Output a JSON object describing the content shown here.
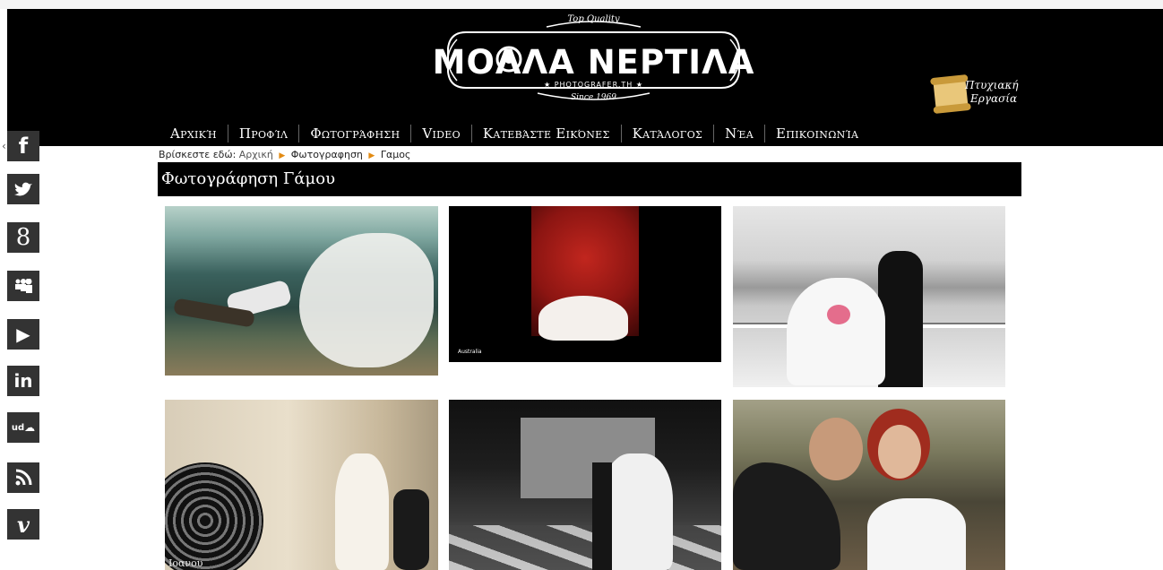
{
  "logo": {
    "top": "Top Quality",
    "main": "ΜΟΛΛΑ ΝΕΡΤΙΛΑ",
    "sub": "★ PHOTOGRAFER.TH ★",
    "since": "Since 1969"
  },
  "thesis": {
    "line1": "Πτυχιακή",
    "line2": "Εργασία"
  },
  "nav": [
    "Αρχική",
    "Προφίλ",
    "Φωτογράφηση",
    "Video",
    "Κατεβάστε Εικόνες",
    "Κατάλογος",
    "Νέα",
    "Επικοινωνία"
  ],
  "social": [
    "f",
    "t",
    "8",
    "ms",
    "▶",
    "in",
    "ud",
    "rss",
    "v"
  ],
  "social_icons": [
    "facebook-icon",
    "twitter-icon",
    "google-plus-icon",
    "myspace-icon",
    "youtube-icon",
    "linkedin-icon",
    "soundcloud-icon",
    "rss-icon",
    "vimeo-icon"
  ],
  "breadcrumb": {
    "prefix": "Βρίσκεστε εδώ:",
    "home": "Αρχική",
    "section": "Φωτογραφηση",
    "current": "Γαμος"
  },
  "page_title": "Φωτογράφηση Γάμου",
  "gallery": {
    "caption_t2": "Australia",
    "caption_t4": "Ιοανου"
  },
  "colors": {
    "header_bg": "#000000",
    "breadcrumb_arrow": "#e38b13",
    "social_bg": "#333333"
  }
}
